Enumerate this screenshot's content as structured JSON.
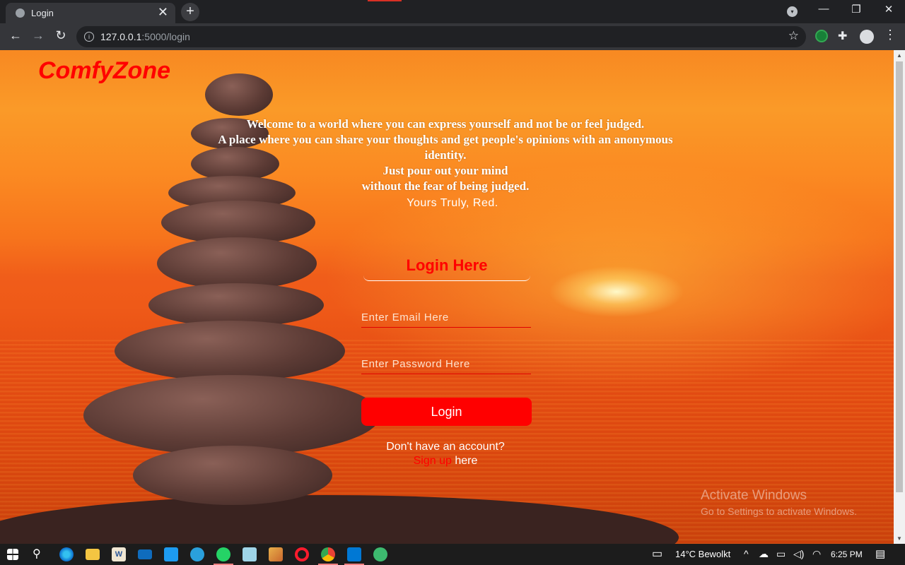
{
  "browser": {
    "tab_title": "Login",
    "tab_close_glyph": "✕",
    "new_tab_glyph": "+",
    "url_host": "127.0.0.1",
    "url_path": ":5000/login",
    "icons": [
      "globe-icon",
      "tab-search-icon",
      "back-arrow-icon",
      "forward-arrow-icon",
      "reload-icon",
      "info-icon",
      "bookmark-star-icon",
      "extension-icon",
      "puzzle-icon",
      "profile-avatar-icon",
      "menu-kebab-icon"
    ]
  },
  "page": {
    "brand": "ComfyZone",
    "intro_lines": [
      "Welcome to a world where you can express yourself and not be or feel judged.",
      "A place where you can share your thoughts and get people's opinions with an anonymous identity.",
      "Just pour out your mind",
      "without the fear of being judged."
    ],
    "signature": "Yours Truly, Red.",
    "form": {
      "heading": "Login Here",
      "email_placeholder": "Enter Email Here",
      "password_placeholder": "Enter Password Here",
      "submit_label": "Login",
      "no_account_text": "Don't have an account?",
      "signup_link": "Sign up",
      "signup_suffix": " here"
    },
    "watermark": {
      "title": "Activate Windows",
      "subtitle": "Go to Settings to activate Windows."
    }
  },
  "taskbar": {
    "weather": "14°C  Bewolkt",
    "time": "6:25 PM",
    "pinned_apps": [
      "windows-start-icon",
      "search-icon",
      "edge-icon",
      "file-explorer-icon",
      "word-icon",
      "mail-icon",
      "twitter-icon",
      "telegram-icon",
      "whatsapp-icon",
      "notepad-icon",
      "paint-icon",
      "opera-icon",
      "chrome-icon",
      "vscode-icon",
      "vpn-icon"
    ]
  },
  "colors": {
    "brand_red": "#ff0000",
    "button_red": "#ff0000",
    "sky_orange": "#f88922",
    "sea_orange": "#e24c12"
  }
}
